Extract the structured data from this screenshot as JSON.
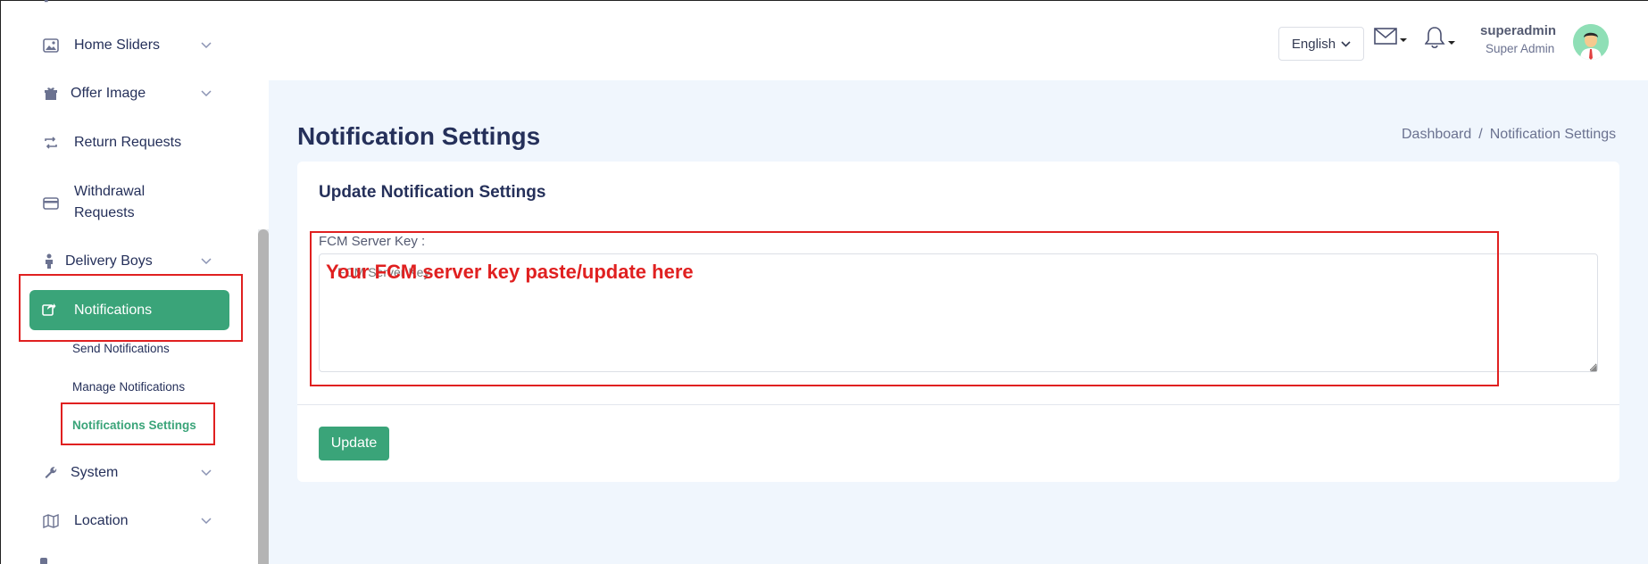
{
  "sidebar": {
    "items": [
      {
        "label": "Home Sliders",
        "icon": "image-icon"
      },
      {
        "label": "Offer Image",
        "icon": "gift-icon"
      },
      {
        "label": "Return Requests",
        "icon": "return-icon"
      },
      {
        "label": "Withdrawal",
        "label2": "Requests",
        "icon": "card-icon"
      },
      {
        "label": "Delivery Boys",
        "icon": "person-icon"
      },
      {
        "label": "Notifications",
        "icon": "share-icon"
      },
      {
        "label": "System",
        "icon": "wrench-icon"
      },
      {
        "label": "Location",
        "icon": "map-icon"
      }
    ],
    "sub_items": [
      {
        "label": "Send Notifications"
      },
      {
        "label": "Manage Notifications"
      },
      {
        "label": "Notifications Settings"
      }
    ]
  },
  "header": {
    "language": "English",
    "user_name": "superadmin",
    "user_role": "Super Admin"
  },
  "page": {
    "title": "Notification Settings",
    "breadcrumb": [
      "Dashboard",
      "Notification Settings"
    ]
  },
  "form": {
    "card_title": "Update Notification Settings",
    "field_label": "FCM Server Key :",
    "placeholder": "FCM Server Key",
    "annotation": "Your FCM server key paste/update here",
    "submit_label": "Update"
  },
  "colors": {
    "accent": "#3aa479",
    "annotation_red": "#e02020",
    "main_bg": "#f0f6fd"
  }
}
